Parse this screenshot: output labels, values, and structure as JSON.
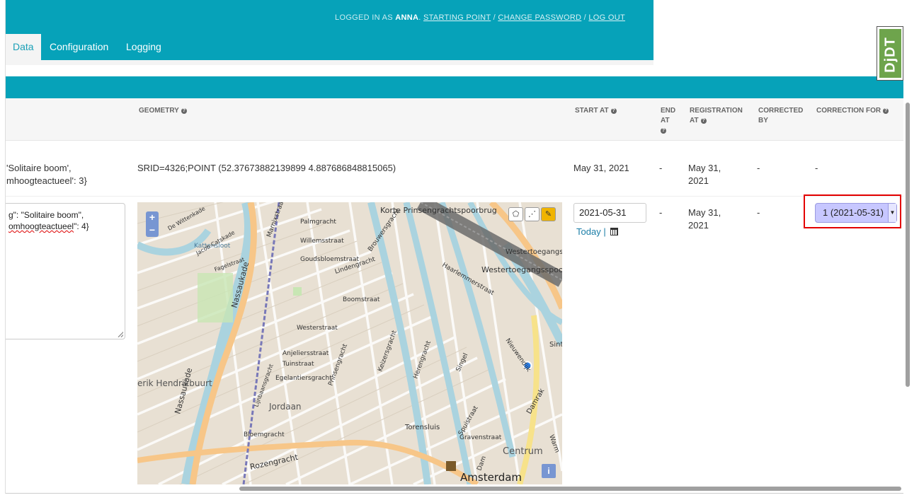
{
  "user_tools": {
    "prefix": "LOGGED IN AS",
    "username": "ANNA",
    "starting_point": "STARTING POINT",
    "change_password": "CHANGE PASSWORD",
    "log_out": "LOG OUT",
    "sep1": ".",
    "sep2": "/",
    "sep3": "/"
  },
  "nav": {
    "tabs": [
      {
        "label": "Data",
        "active": true
      },
      {
        "label": "Configuration",
        "active": false
      },
      {
        "label": "Logging",
        "active": false
      }
    ]
  },
  "table": {
    "headers": {
      "geometry": "GEOMETRY",
      "start_at": "START AT",
      "end_at_1": "END",
      "end_at_2": "AT",
      "registration_1": "REGISTRATION",
      "registration_2": "AT",
      "corrected_1": "CORRECTED",
      "corrected_2": "BY",
      "correction_for": "CORRECTION FOR"
    },
    "row1": {
      "data_line1": "'Solitaire boom',",
      "data_line2": "mhoogteactueel': 3}",
      "geometry": "SRID=4326;POINT (52.37673882139899 4.887686848815065)",
      "start_at": "May 31, 2021",
      "end_at": "-",
      "registration_1": "May 31,",
      "registration_2": "2021",
      "corrected_by": "-",
      "correction_for": "-"
    },
    "row2": {
      "data_line1a": "g\": \"Solitaire boom\",",
      "data_line2a": "omhoogteactueel",
      "data_line2b": "\": 4}",
      "start_at_value": "2021-05-31",
      "today_link": "Today",
      "today_sep": "|",
      "end_at": "-",
      "registration_1": "May 31,",
      "registration_2": "2021",
      "corrected_by": "-",
      "correction_for_selected": "1 (2021-05-31)"
    }
  },
  "map": {
    "zoom_in": "+",
    "zoom_out": "−",
    "info": "i",
    "labels": {
      "korte": "Korte Prinsengrachtspoorbrug",
      "wt1": "Westertoegangsl",
      "wt2": "Westertoegangsspoor",
      "ehb": "erik Hendrikbuurt",
      "jordaan": "Jordaan",
      "centrum": "Centrum",
      "amsterdam": "Amsterdam",
      "torensluis": "Torensluis",
      "nassaukade1": "Nassaukade",
      "nassaukade2": "Nassaukade",
      "rozengracht": "Rozengracht",
      "kattensloot": "Kattensloot",
      "westerstraat": "Westerstraat",
      "lindengracht": "Lindengracht",
      "prinsengracht": "Prinsengracht",
      "keizersgracht": "Keizersgracht",
      "herengracht": "Herengracht",
      "singel": "Singel",
      "damrak": "Damrak",
      "spuistraat": "Spuistraat",
      "nieuwendijk": "Nieuwendijk",
      "palmgracht": "Palmgracht",
      "brouwersgracht": "Brouwersgracht",
      "bloemgracht": "Bloemgracht",
      "egelantiersgracht": "Egelantiersgracht",
      "anjeliersstraat": "Anjeliersstraat",
      "tuinstraat": "Tuinstraat",
      "boomstraat": "Boomstraat",
      "haarlemmerstraat": "Haarlemmerstraat",
      "marnixstraat": "Marnixstraat",
      "sint": "Sint",
      "warm": "Warm",
      "dam": "Dam",
      "gravenstraat": "Gravenstraat",
      "de_wittenkade": "De Wittenkade",
      "jacob_catskade": "Jacob Catskade",
      "fagelstraat": "Fagelstraat",
      "goudsbloemstraat": "Goudsbloemstraat",
      "willemsstraat": "Willemsstraat",
      "lijnbaansgracht": "Lijnbaansgracht"
    }
  },
  "debug_toolbar": {
    "label": "DjDT"
  },
  "colors": {
    "accent": "#06a2b9",
    "highlight_box": "#e30000",
    "select_bg": "#c7c7ff"
  }
}
